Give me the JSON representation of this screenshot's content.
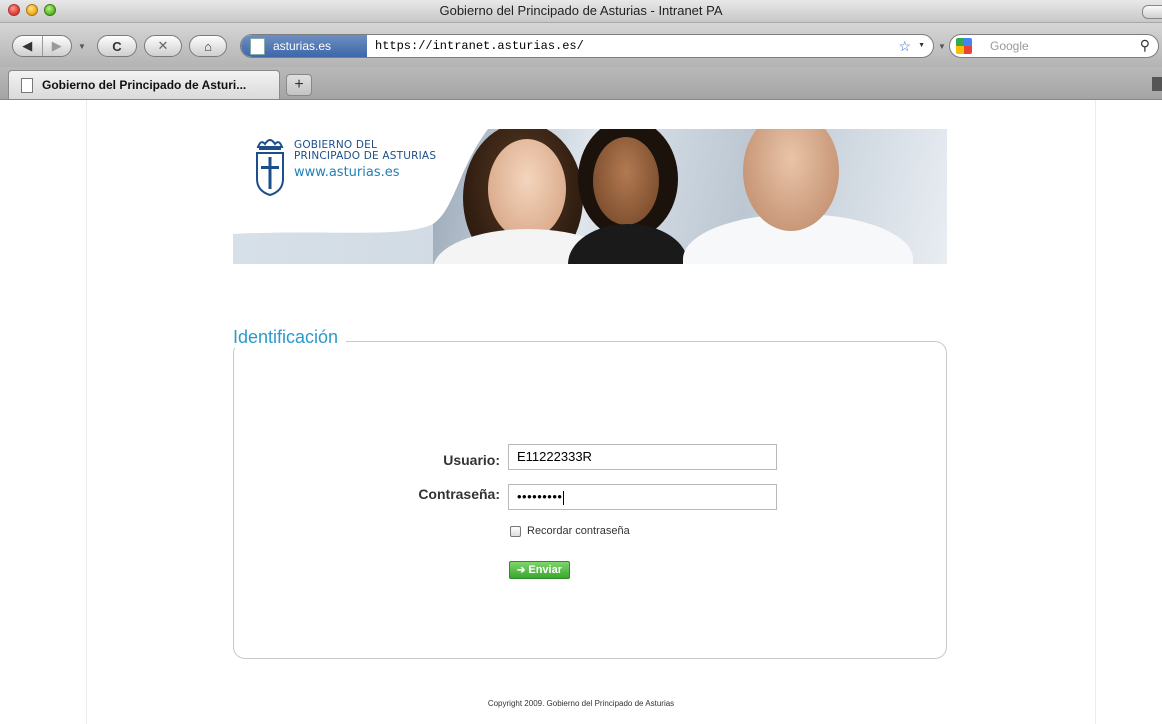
{
  "window": {
    "title": "Gobierno del Principado de Asturias - Intranet PA"
  },
  "toolbar": {
    "back_icon": "◀",
    "forward_icon": "▶",
    "reload_icon": "C",
    "stop_icon": "✕",
    "home_icon": "⌂",
    "site_identity": "asturias.es",
    "url": "https://intranet.asturias.es/",
    "bookmark_icon": "☆",
    "search_placeholder": "Google",
    "search_icon": "⚲"
  },
  "tabs": [
    {
      "label": "Gobierno del Principado de Asturi..."
    }
  ],
  "new_tab_label": "+",
  "banner": {
    "org_line1": "GOBIERNO DEL",
    "org_line2": "PRINCIPADO DE ASTURIAS",
    "org_url": "www.asturias.es"
  },
  "login": {
    "legend": "Identificación",
    "user_label": "Usuario:",
    "user_value": "E11222333R",
    "password_label": "Contraseña:",
    "password_value": "•••••••••",
    "remember_label": "Recordar contraseña",
    "remember_checked": false,
    "submit_label": "Enviar"
  },
  "footer": {
    "copyright": "Copyright 2009. Gobierno del Principado de Asturias"
  },
  "colors": {
    "accent": "#2a9acb",
    "submit": "#3aa72c",
    "logo_blue": "#1c4f8a"
  }
}
